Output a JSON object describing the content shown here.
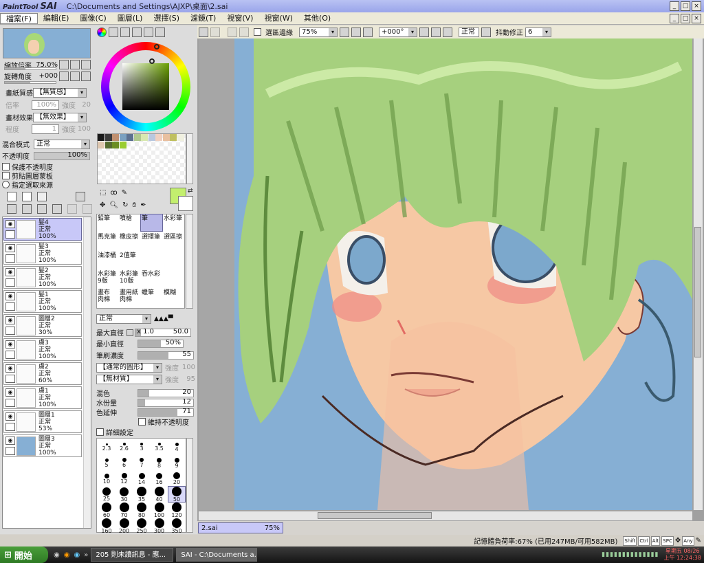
{
  "app": {
    "logo_small": "PaintTool",
    "logo_big": "SAI",
    "path": "C:\\Documents and Settings\\AJXP\\桌面\\2.sai"
  },
  "menu": [
    "檔案(F)",
    "編輯(E)",
    "圖像(C)",
    "圖層(L)",
    "選擇(S)",
    "濾鏡(T)",
    "視窗(V)",
    "視窗(W)",
    "其他(O)"
  ],
  "navigator": {
    "zoom_label": "縮放倍率",
    "zoom_value": "75.0%",
    "rotate_label": "旋轉角度",
    "rotate_value": "+000"
  },
  "paper": {
    "texture_label": "畫紙質感",
    "texture_value": "【無質感】",
    "scale_label": "倍率",
    "scale_value": "100%",
    "strength_label": "強度",
    "strength_value": "20",
    "effect_label": "畫材效果",
    "effect_value": "【無效果】",
    "width_label": "程度",
    "width_value": "1",
    "strength2_value": "100"
  },
  "blend": {
    "mode_label": "混合模式",
    "mode_value": "正常",
    "opacity_label": "不透明度",
    "opacity_value": "100%",
    "checks": [
      "保護不透明度",
      "剪貼圖層蒙板",
      "指定選取來源"
    ]
  },
  "layers": [
    {
      "name": "髮4",
      "mode": "正常",
      "opacity": "100%",
      "selected": true
    },
    {
      "name": "髮3",
      "mode": "正常",
      "opacity": "100%"
    },
    {
      "name": "髮2",
      "mode": "正常",
      "opacity": "100%"
    },
    {
      "name": "髮1",
      "mode": "正常",
      "opacity": "100%"
    },
    {
      "name": "圖層2",
      "mode": "正常",
      "opacity": "30%"
    },
    {
      "name": "膚3",
      "mode": "正常",
      "opacity": "100%"
    },
    {
      "name": "膚2",
      "mode": "正常",
      "opacity": "60%"
    },
    {
      "name": "膚1",
      "mode": "正常",
      "opacity": "100%"
    },
    {
      "name": "圖層1",
      "mode": "正常",
      "opacity": "53%"
    },
    {
      "name": "圖層3",
      "mode": "正常",
      "opacity": "100%"
    }
  ],
  "tools": [
    "鉛筆",
    "噴槍",
    "筆",
    "水彩筆",
    "馬克筆",
    "橡皮擦",
    "選擇筆",
    "選區擦",
    "油漆桶",
    "2值筆",
    "",
    "",
    "水彩筆 9版",
    "水彩筆 10版",
    "吞水彩",
    "",
    "畫布 肉棉",
    "畫用紙 肉棉",
    "蠟筆",
    "模糊"
  ],
  "brush": {
    "mode": "正常",
    "max_label": "最大直徑",
    "max_mult": "x 1.0",
    "max_value": "50.0",
    "min_label": "最小直徑",
    "min_value": "50%",
    "density_label": "筆刷濃度",
    "density_value": "55",
    "shape": "【通常的圓形】",
    "shape_strength_label": "強度",
    "shape_strength": "100",
    "texture": "【無材質】",
    "texture_strength_label": "強度",
    "texture_strength": "95",
    "blend_label": "混色",
    "blend_value": "20",
    "water_label": "水份量",
    "water_value": "12",
    "persist_label": "色延伸",
    "persist_value": "71",
    "keep_opacity": "維持不透明度",
    "detail": "詳細設定"
  },
  "brush_sizes": [
    "2.3",
    "2.6",
    "3",
    "3.5",
    "4",
    "5",
    "6",
    "7",
    "8",
    "9",
    "10",
    "12",
    "14",
    "16",
    "20",
    "25",
    "30",
    "35",
    "40",
    "50",
    "60",
    "70",
    "80",
    "100",
    "120",
    "160",
    "200",
    "250",
    "300",
    "350"
  ],
  "toolbar": {
    "show_selection": "選區邊緣",
    "zoom": "75%",
    "rotate": "+000°",
    "mode": "正常",
    "stabilizer_label": "抖動修正",
    "stabilizer_value": "6"
  },
  "doc_tab": {
    "name": "2.sai",
    "zoom": "75%"
  },
  "status": {
    "memory": "記憶體負荷率:67% (已用247MB/可用582MB)",
    "keys": [
      "Shift",
      "Ctrl",
      "Alt",
      "SPC",
      "Any"
    ]
  },
  "taskbar": {
    "start": "開始",
    "tasks": [
      "205 則未讀訊息 - 應...",
      "SAI - C:\\Documents a..."
    ],
    "time_line1": "星期五 08/26",
    "time_line2": "上午 12:24:38"
  },
  "swatch_colors": [
    "#1a1a1a",
    "#3a3a3a",
    "#c09070",
    "#7aa0c0",
    "#5c7090",
    "#b0c890",
    "#d8e8b0",
    "#b8c8e0",
    "#f0d0c0",
    "#e8c0a0",
    "#c0c060",
    "#f0f0e0",
    "#e0c8b0",
    "#556b2f",
    "#6b8e23",
    "#9acd32"
  ],
  "primary_color": "#c3ef6e"
}
